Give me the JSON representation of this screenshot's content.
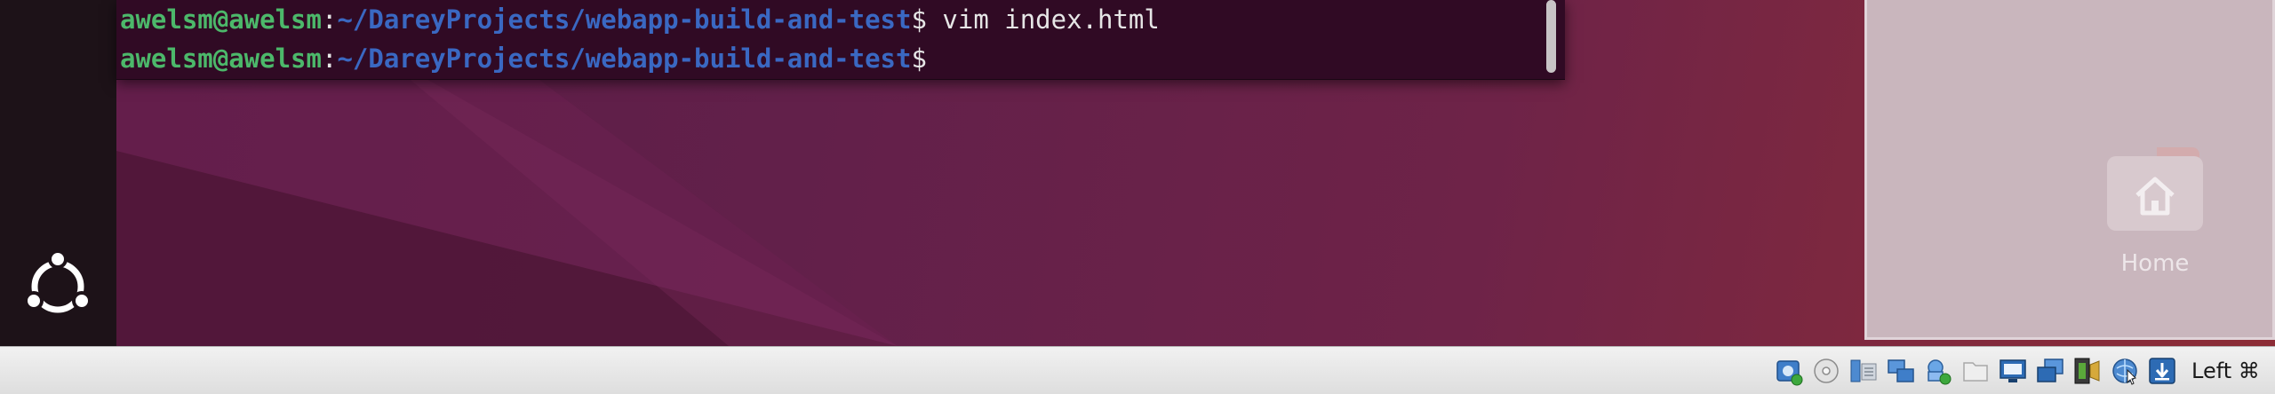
{
  "terminal": {
    "lines": [
      {
        "user": "awelsm@awelsm",
        "colon": ":",
        "path": "~/DareyProjects/webapp-build-and-test",
        "dollar": "$",
        "command": " vim index.html"
      },
      {
        "user": "awelsm@awelsm",
        "colon": ":",
        "path": "~/DareyProjects/webapp-build-and-test",
        "dollar": "$",
        "command": ""
      }
    ]
  },
  "desktop": {
    "home_label": "Home"
  },
  "statusbar": {
    "host_key": "Left ⌘",
    "icons": [
      "hard-disk-icon",
      "optical-drive-icon",
      "audio-icon",
      "network-icon",
      "usb-icon",
      "shared-folders-icon",
      "display-icon",
      "screen-capture-icon",
      "video-recording-icon",
      "mouse-integration-icon",
      "keyboard-capture-icon"
    ]
  },
  "colors": {
    "terminal_bg": "#300a24",
    "prompt_user": "#4cb86a",
    "prompt_path": "#3a68c2",
    "dock_bg": "#1d1218",
    "statusbar_bg": "#e8e8e8"
  }
}
